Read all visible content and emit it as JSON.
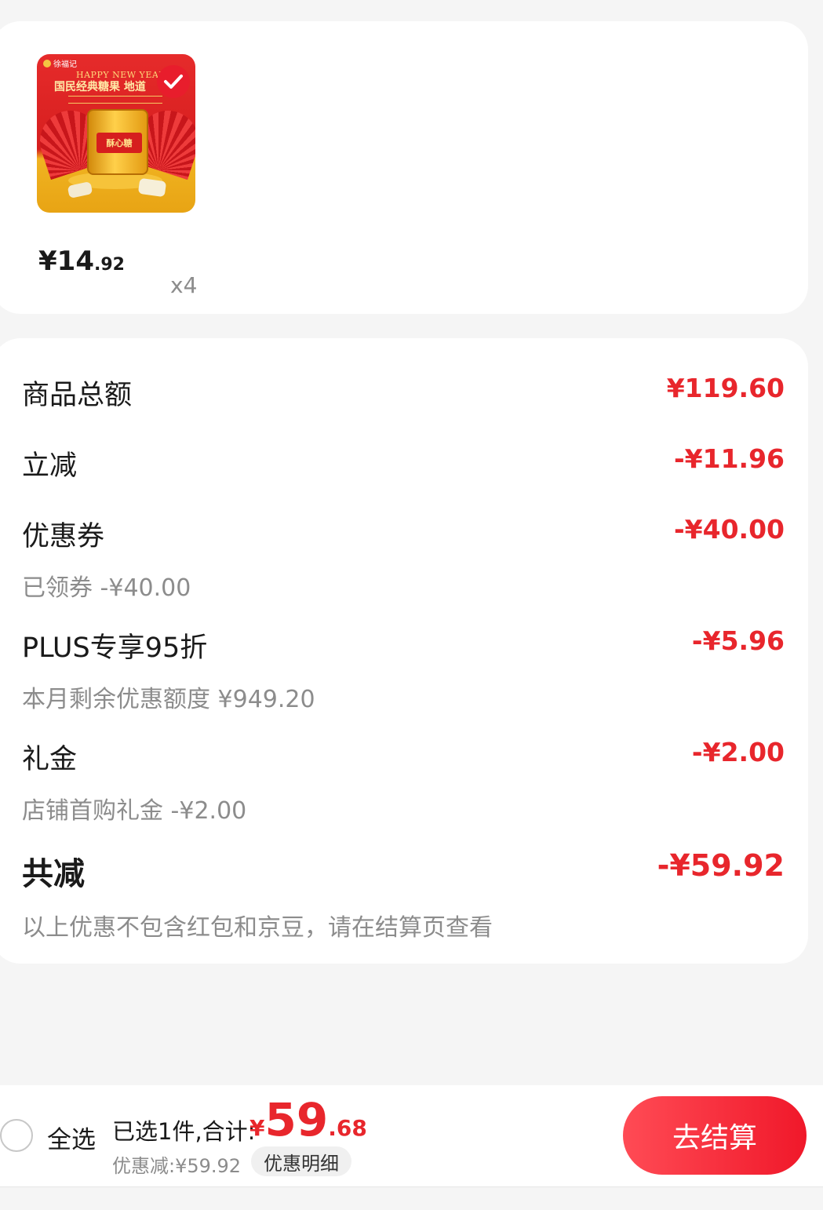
{
  "product": {
    "image_alt": "徐福记 酥心糖 礼罐",
    "image_text": {
      "brand": "徐福记",
      "happy_new_year": "HAPPY NEW YEAR",
      "title": "国民经典糖果 地道",
      "can_label": "酥心糖"
    },
    "price_int": "¥14",
    "price_dec": ".92",
    "quantity": "x4",
    "checked": true
  },
  "summary": {
    "rows": [
      {
        "label": "商品总额",
        "value": "¥119.60",
        "sub": ""
      },
      {
        "label": "立减",
        "value": "-¥11.96",
        "sub": ""
      },
      {
        "label": "优惠券",
        "value": "-¥40.00",
        "sub": "已领券 -¥40.00"
      },
      {
        "label": "PLUS专享95折",
        "value": "-¥5.96",
        "sub": "本月剩余优惠额度 ¥949.20"
      },
      {
        "label": "礼金",
        "value": "-¥2.00",
        "sub": "店铺首购礼金 -¥2.00"
      }
    ],
    "total": {
      "label": "共减",
      "value": "-¥59.92",
      "note": "以上优惠不包含红包和京豆，请在结算页查看"
    }
  },
  "bottom_bar": {
    "select_all_label": "全选",
    "selected_text": "已选1件,合计:",
    "total_currency": "¥",
    "total_int": "59",
    "total_dec": ".68",
    "discount_text": "优惠减:¥59.92",
    "detail_label": "优惠明细",
    "checkout_label": "去结算"
  },
  "colors": {
    "accent": "#e8262c",
    "background": "#f5f5f5",
    "card": "#ffffff",
    "muted_text": "#8c8c8c"
  }
}
